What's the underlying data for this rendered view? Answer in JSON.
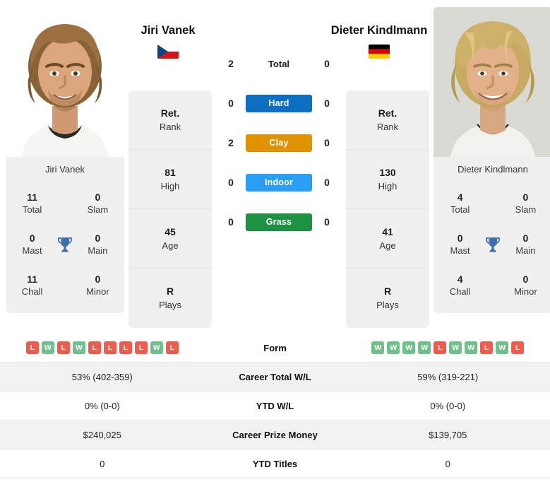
{
  "players": {
    "left": {
      "name": "Jiri Vanek",
      "name_sub": "Jiri Vanek",
      "country": "Czech Republic",
      "flag": "cz",
      "titles": {
        "total": "11",
        "total_label": "Total",
        "slam": "0",
        "slam_label": "Slam",
        "mast": "0",
        "mast_label": "Mast",
        "main": "0",
        "main_label": "Main",
        "chall": "11",
        "chall_label": "Chall",
        "minor": "0",
        "minor_label": "Minor"
      },
      "stats": [
        {
          "value": "Ret.",
          "label": "Rank"
        },
        {
          "value": "81",
          "label": "High"
        },
        {
          "value": "45",
          "label": "Age"
        },
        {
          "value": "R",
          "label": "Plays"
        }
      ],
      "form": [
        "L",
        "W",
        "L",
        "W",
        "L",
        "L",
        "L",
        "L",
        "W",
        "L"
      ],
      "career_total_wl": "53% (402-359)",
      "ytd_wl": "0% (0-0)",
      "career_prize_money": "$240,025",
      "ytd_titles": "0"
    },
    "right": {
      "name": "Dieter Kindlmann",
      "name_sub": "Dieter Kindlmann",
      "country": "Germany",
      "flag": "de",
      "titles": {
        "total": "4",
        "total_label": "Total",
        "slam": "0",
        "slam_label": "Slam",
        "mast": "0",
        "mast_label": "Mast",
        "main": "0",
        "main_label": "Main",
        "chall": "4",
        "chall_label": "Chall",
        "minor": "0",
        "minor_label": "Minor"
      },
      "stats": [
        {
          "value": "Ret.",
          "label": "Rank"
        },
        {
          "value": "130",
          "label": "High"
        },
        {
          "value": "41",
          "label": "Age"
        },
        {
          "value": "R",
          "label": "Plays"
        }
      ],
      "form": [
        "W",
        "W",
        "W",
        "W",
        "L",
        "W",
        "W",
        "L",
        "W",
        "L"
      ],
      "career_total_wl": "59% (319-221)",
      "ytd_wl": "0% (0-0)",
      "career_prize_money": "$139,705",
      "ytd_titles": "0"
    }
  },
  "head_to_head": {
    "total": {
      "label": "Total",
      "left": "2",
      "right": "0"
    },
    "surfaces": [
      {
        "label": "Hard",
        "left": "0",
        "right": "0",
        "color": "#0d6fc2"
      },
      {
        "label": "Clay",
        "left": "2",
        "right": "0",
        "color": "#e09200"
      },
      {
        "label": "Indoor",
        "left": "0",
        "right": "0",
        "color": "#2a9df4"
      },
      {
        "label": "Grass",
        "left": "0",
        "right": "0",
        "color": "#1d9243"
      }
    ]
  },
  "table": {
    "rows": [
      {
        "label": "Form",
        "left": "",
        "right": "",
        "type": "form"
      },
      {
        "label": "Career Total W/L",
        "left": "53% (402-359)",
        "right": "59% (319-221)",
        "type": "text"
      },
      {
        "label": "YTD W/L",
        "left": "0% (0-0)",
        "right": "0% (0-0)",
        "type": "text"
      },
      {
        "label": "Career Prize Money",
        "left": "$240,025",
        "right": "$139,705",
        "type": "text"
      },
      {
        "label": "YTD Titles",
        "left": "0",
        "right": "0",
        "type": "text"
      }
    ]
  },
  "colors": {
    "hard": "#0d6fc2",
    "clay": "#e09200",
    "indoor": "#2a9df4",
    "grass": "#1d9243",
    "win": "#6fc08a",
    "loss": "#ef5b4c",
    "trophy": "#3d6fa8",
    "card_bg": "#f0f0f0"
  }
}
